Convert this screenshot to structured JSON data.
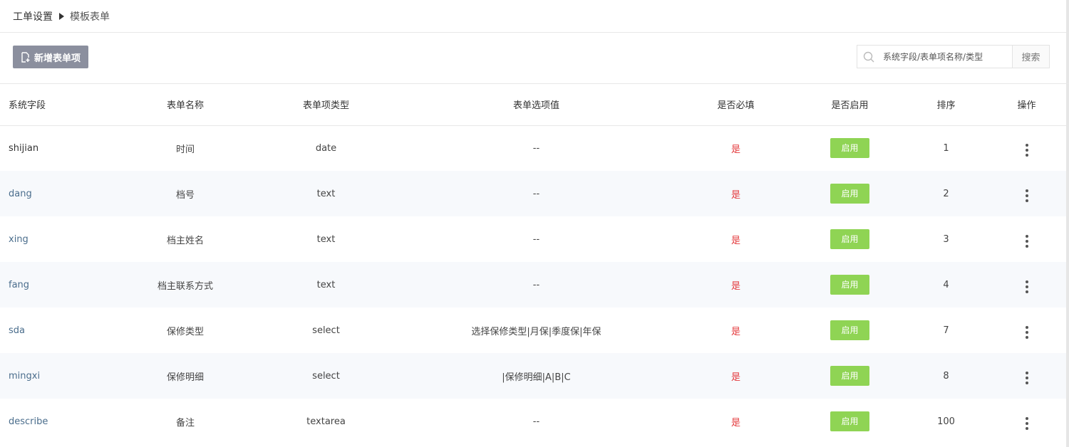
{
  "breadcrumb": {
    "parent": "工单设置",
    "current": "模板表单"
  },
  "toolbar": {
    "add_label": "新增表单项",
    "search_placeholder": "系统字段/表单项名称/类型",
    "search_button": "搜索"
  },
  "table": {
    "headers": [
      "系统字段",
      "表单名称",
      "表单项类型",
      "表单选项值",
      "是否必填",
      "是否启用",
      "排序",
      "操作"
    ],
    "rows": [
      {
        "field": "shijian",
        "name": "时间",
        "type": "date",
        "options": "--",
        "required": "是",
        "enabled": "启用",
        "order": "1"
      },
      {
        "field": "dang",
        "name": "档号",
        "type": "text",
        "options": "--",
        "required": "是",
        "enabled": "启用",
        "order": "2"
      },
      {
        "field": "xing",
        "name": "档主姓名",
        "type": "text",
        "options": "--",
        "required": "是",
        "enabled": "启用",
        "order": "3"
      },
      {
        "field": "fang",
        "name": "档主联系方式",
        "type": "text",
        "options": "--",
        "required": "是",
        "enabled": "启用",
        "order": "4"
      },
      {
        "field": "sda",
        "name": "保修类型",
        "type": "select",
        "options": "选择保修类型|月保|季度保|年保",
        "required": "是",
        "enabled": "启用",
        "order": "7"
      },
      {
        "field": "mingxi",
        "name": "保修明细",
        "type": "select",
        "options": "|保修明细|A|B|C",
        "required": "是",
        "enabled": "启用",
        "order": "8"
      },
      {
        "field": "describe",
        "name": "备注",
        "type": "textarea",
        "options": "--",
        "required": "是",
        "enabled": "启用",
        "order": "100"
      }
    ]
  },
  "colors": {
    "enable_green": "#8fd454",
    "required_red": "#e4393c",
    "add_button_gray": "#8b8f9e"
  },
  "icons": {
    "add": "add-document-icon",
    "search": "search-icon",
    "more": "more-vertical-icon",
    "breadcrumb_sep": "caret-right-icon"
  }
}
